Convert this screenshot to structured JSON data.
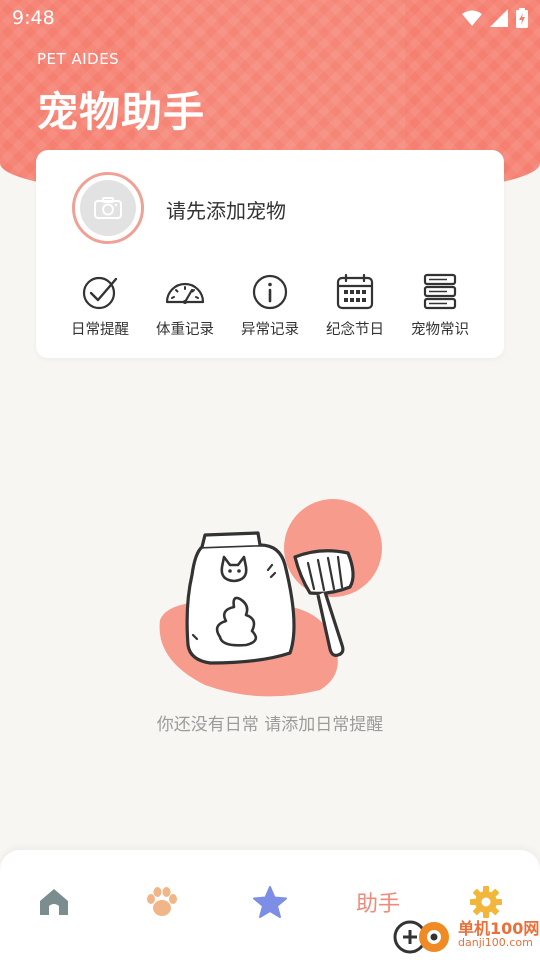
{
  "status": {
    "time": "9:48"
  },
  "header": {
    "subtitle": "PET AIDES",
    "title": "宠物助手"
  },
  "pet_card": {
    "prompt": "请先添加宠物",
    "features": [
      {
        "label": "日常提醒",
        "icon": "check-circle-icon"
      },
      {
        "label": "体重记录",
        "icon": "gauge-icon"
      },
      {
        "label": "异常记录",
        "icon": "info-icon"
      },
      {
        "label": "纪念节日",
        "icon": "calendar-icon"
      },
      {
        "label": "宠物常识",
        "icon": "server-stack-icon"
      }
    ]
  },
  "empty_state": {
    "text": "你还没有日常 请添加日常提醒"
  },
  "tabbar": {
    "tabs": [
      {
        "name": "home",
        "icon": "home-icon"
      },
      {
        "name": "paw",
        "icon": "paw-icon"
      },
      {
        "name": "star",
        "icon": "star-icon"
      },
      {
        "name": "assistant",
        "label": "助手"
      },
      {
        "name": "settings",
        "icon": "gear-icon"
      }
    ]
  },
  "watermark": {
    "line1": "单机100网",
    "line2": "danji100.com"
  },
  "colors": {
    "accent": "#f57f70",
    "background": "#f8f6f3",
    "muted_text": "#9b9b9b"
  }
}
